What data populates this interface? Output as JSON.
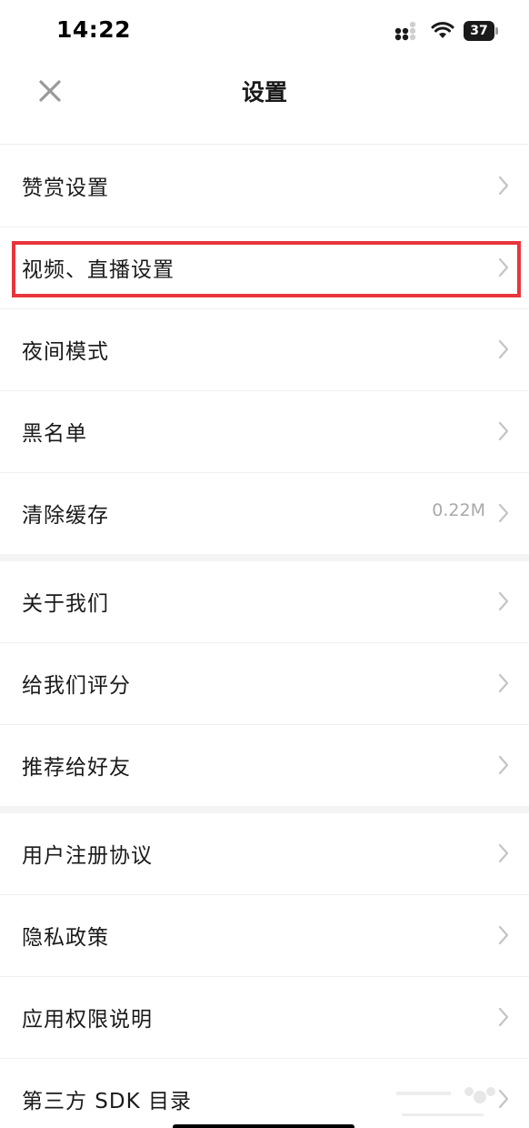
{
  "status_bar": {
    "time": "14:22",
    "battery": "37",
    "icons": [
      "signal-icon",
      "wifi-icon",
      "battery-icon"
    ]
  },
  "nav": {
    "title": "设置",
    "close_icon": "close-icon"
  },
  "groups": [
    {
      "items": [
        {
          "label": "赞赏设置",
          "value": ""
        },
        {
          "label": "视频、直播设置",
          "value": "",
          "highlighted": true
        },
        {
          "label": "夜间模式",
          "value": ""
        },
        {
          "label": "黑名单",
          "value": ""
        },
        {
          "label": "清除缓存",
          "value": "0.22M"
        }
      ]
    },
    {
      "items": [
        {
          "label": "关于我们",
          "value": ""
        },
        {
          "label": "给我们评分",
          "value": ""
        },
        {
          "label": "推荐给好友",
          "value": ""
        }
      ]
    },
    {
      "items": [
        {
          "label": "用户注册协议",
          "value": ""
        },
        {
          "label": "隐私政策",
          "value": ""
        },
        {
          "label": "应用权限说明",
          "value": ""
        },
        {
          "label": "第三方 SDK 目录",
          "value": ""
        }
      ]
    }
  ],
  "colors": {
    "highlight": "#e8353c",
    "chevron": "#c4c4c4",
    "secondary_text": "#a9a9a9",
    "group_gap": "#f4f4f4"
  }
}
